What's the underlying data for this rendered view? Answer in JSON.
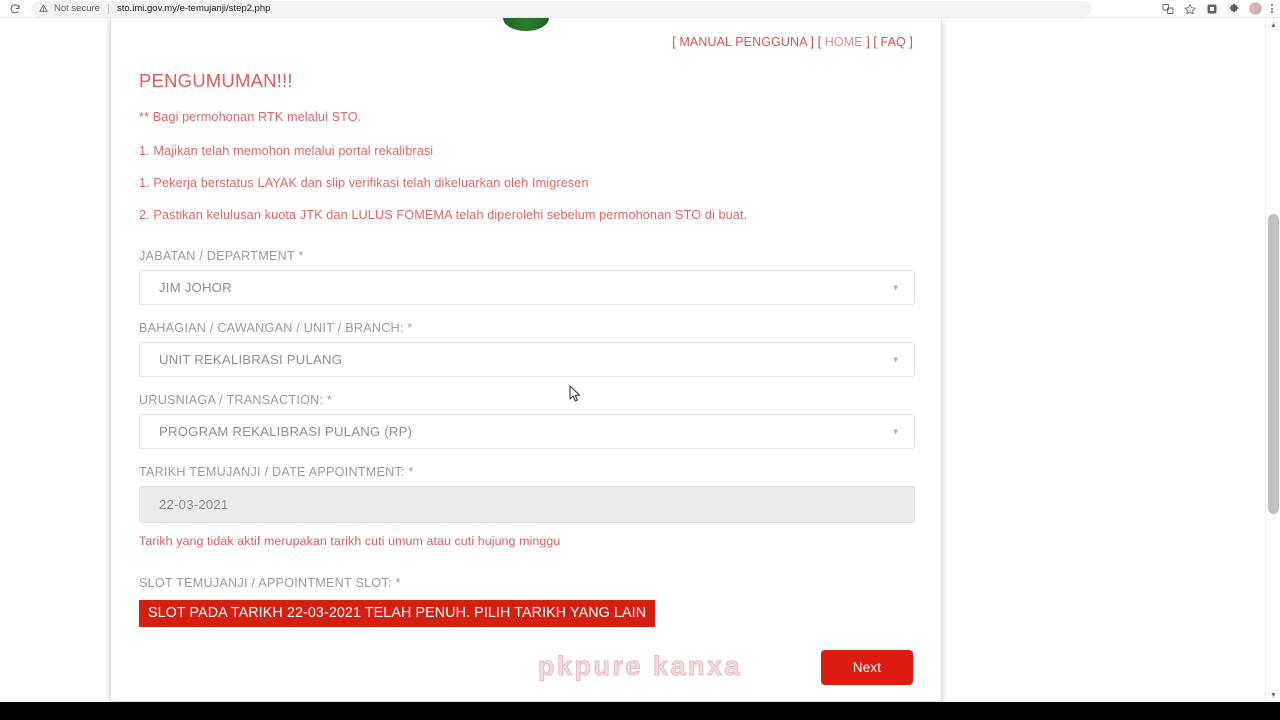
{
  "browser": {
    "reload_icon": "reload-icon",
    "warn_icon": "warning-triangle-icon",
    "security_label": "Not secure",
    "url": "sto.imi.gov.my/e-temujanji/step2.php",
    "toolbar_icons": [
      {
        "name": "translate-icon",
        "glyph": "固"
      },
      {
        "name": "bookmark-star-icon",
        "glyph": "☆"
      },
      {
        "name": "extension-badge-icon",
        "glyph": "▣"
      },
      {
        "name": "extensions-puzzle-icon",
        "glyph": "✦"
      },
      {
        "name": "profile-avatar",
        "glyph": ""
      },
      {
        "name": "chrome-menu-icon",
        "glyph": ""
      }
    ]
  },
  "header": {
    "logo": "imigresen-emblem",
    "nav": {
      "manual": "MANUAL PENGGUNA",
      "home": "HOME",
      "faq": "FAQ",
      "open_bracket": "[",
      "close_bracket": "]"
    }
  },
  "announcement": {
    "title": "PENGUMUMAN!!!",
    "lines": [
      "** Bagi permohonan RTK melalui STO.",
      "1. Majikan telah memohon melalui portal rekalibrasi",
      "1. Pekerja berstatus LAYAK dan slip verifikasi telah dikeluarkan oleh Imigresen",
      "2. Pastikan kelulusan kuota JTK dan LULUS FOMEMA telah diperolehi sebelum permohonan STO di buat."
    ]
  },
  "form": {
    "department": {
      "label": "JABATAN / DEPARTMENT *",
      "value": "JIM JOHOR"
    },
    "branch": {
      "label": "BAHAGIAN / CAWANGAN / UNIT / BRANCH: *",
      "value": "UNIT REKALIBRASI PULANG"
    },
    "transaction": {
      "label": "URUSNIAGA / TRANSACTION: *",
      "value": "PROGRAM REKALIBRASI PULANG (RP)"
    },
    "date": {
      "label": "TARIKH TEMUJANJI / DATE APPOINTMENT: *",
      "value": "22-03-2021",
      "note": "Tarikh yang tidak aktif merupakan tarikh cuti umum atau cuti hujung minggu"
    },
    "slot": {
      "label": "SLOT TEMUJANJI / APPOINTMENT SLOT: *",
      "alert": "SLOT PADA TARIKH 22-03-2021 TELAH PENUH. PILIH TARIKH YANG LAIN"
    },
    "next_label": "Next"
  },
  "watermark": "pkpure kanxa",
  "colors": {
    "alert_red": "#d41f11",
    "button_red": "#dd1b10",
    "announce_red": "#e06767",
    "label_grey": "#9b9b9b"
  }
}
